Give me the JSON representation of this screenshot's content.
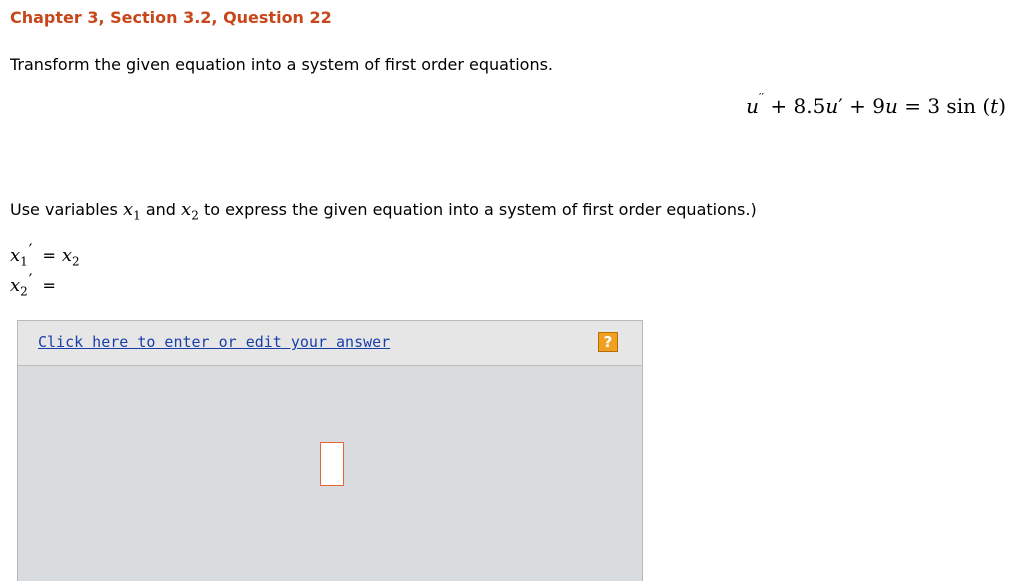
{
  "header": {
    "title": "Chapter 3, Section 3.2, Question 22"
  },
  "problem": {
    "instruction": "Transform the given equation into a system of first order equations.",
    "equation": {
      "lhs_u1": "u",
      "lhs_primes1": "′′",
      "plus1": "+",
      "coef1": "8.5",
      "u2": "u",
      "prime2": "′",
      "plus2": "+",
      "coef2": "9",
      "u3": "u",
      "equals": "=",
      "rhs": "3 sin (",
      "rhs_var": "t",
      "rhs_close": ")"
    },
    "use_text_1": "Use variables",
    "var1_base": "x",
    "var1_sub": "1",
    "and_text": "and",
    "var2_base": "x",
    "var2_sub": "2",
    "use_text_2": "to express the given equation into a system of first order equations.)"
  },
  "system": {
    "row1": {
      "lhs_base": "x",
      "lhs_sub": "1",
      "prime": "′",
      "equals": "=",
      "rhs_base": "x",
      "rhs_sub": "2"
    },
    "row2": {
      "lhs_base": "x",
      "lhs_sub": "2",
      "prime": "′",
      "equals": "="
    }
  },
  "answer": {
    "link_label": "Click here to enter or edit your answer",
    "help_symbol": "?"
  },
  "colors": {
    "title": "#c8461a",
    "link": "#1a3fa8",
    "help_icon": "#f0a020",
    "answer_area": "#d9dcdf",
    "cursor_border": "#e0663a"
  },
  "icons": {
    "help": "question-mark-icon"
  }
}
